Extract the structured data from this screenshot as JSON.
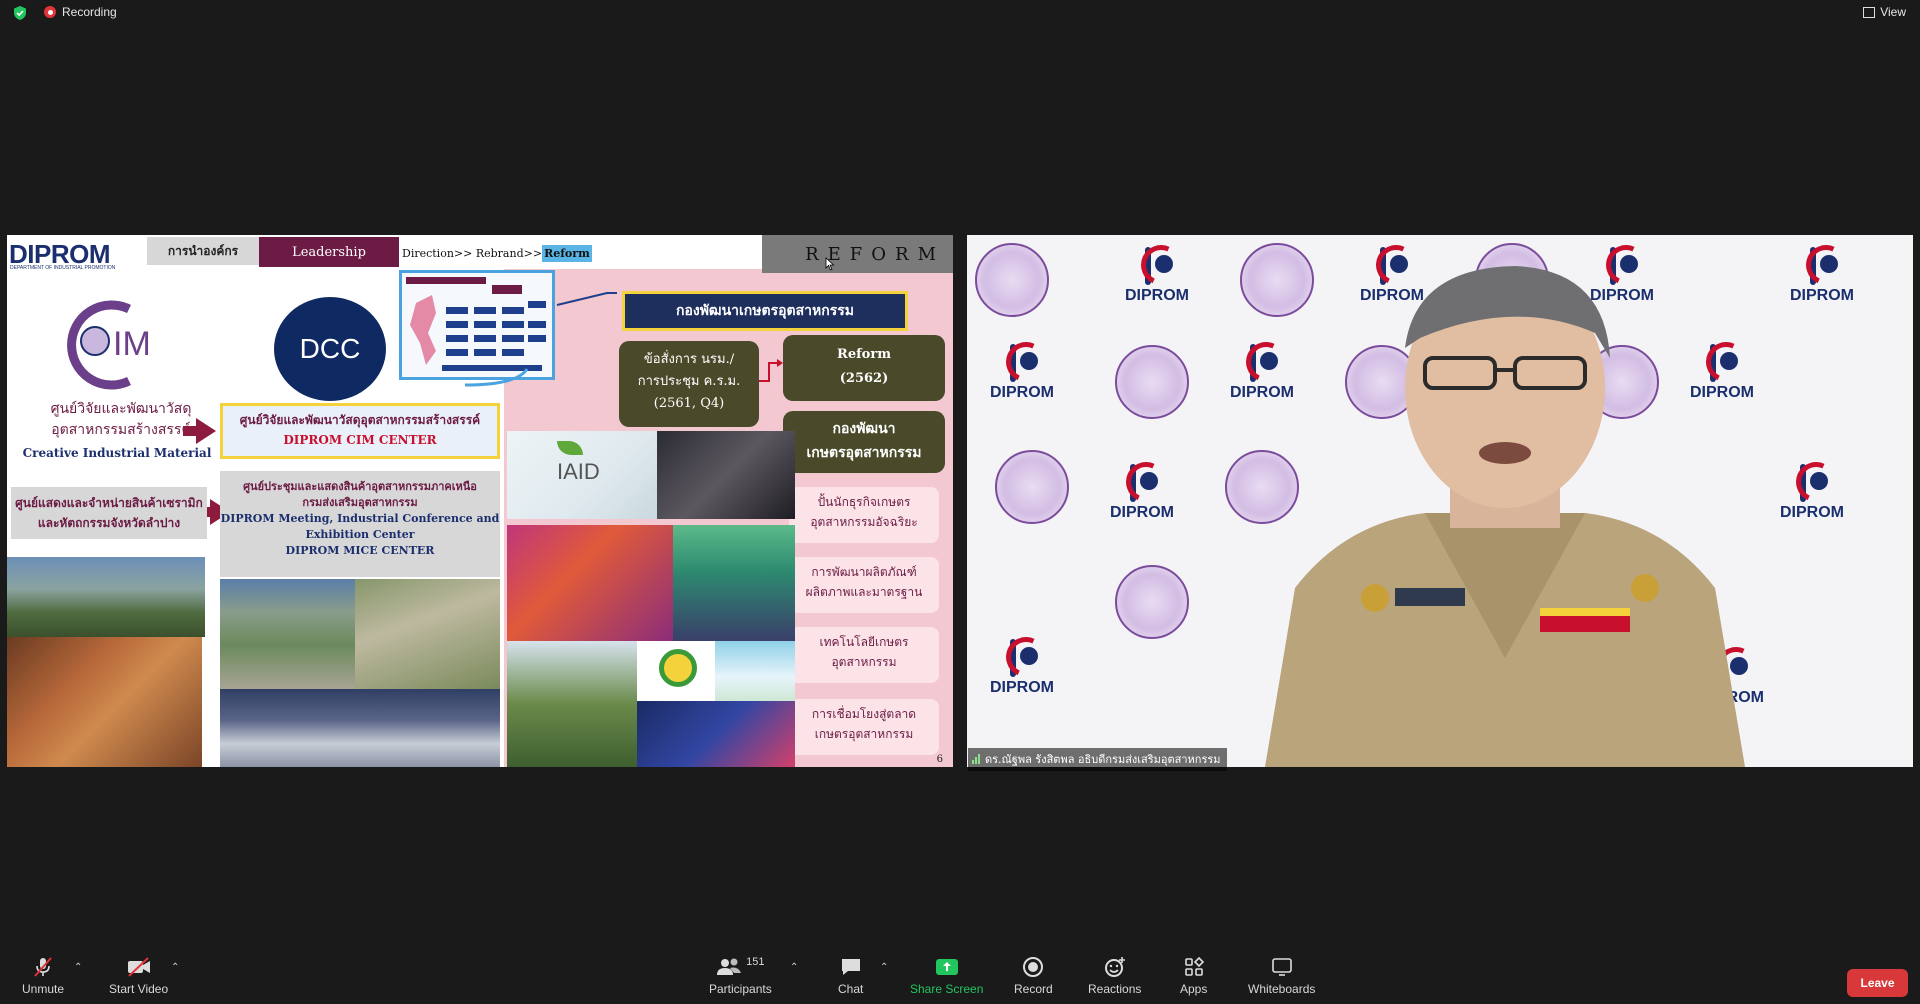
{
  "topbar": {
    "recording_label": "Recording",
    "view_label": "View"
  },
  "slide": {
    "logo_text": "DIPROM",
    "logo_sub": "DEPARTMENT OF INDUSTRIAL PROMOTION",
    "tab_org": "การนำองค์กร",
    "tab_leadership": "Leadership",
    "crumb_prefix": "Direction>> Rebrand>>",
    "crumb_active": "Reform",
    "reform_title": "REFORM",
    "cim_line1": "ศูนย์วิจัยและพัฒนาวัสดุ",
    "cim_line2": "อุตสาหกรรมสร้างสรรค์",
    "cim_en": "Creative Industrial Material",
    "dcc_label": "DCC",
    "cim_box_th": "ศูนย์วิจัยและพัฒนาวัสดุอุตสาหกรรมสร้างสรรค์",
    "cim_box_en": "DIPROM CIM CENTER",
    "lampang_line1": "ศูนย์แสดงและจำหน่ายสินค้าเซรามิก",
    "lampang_line2": "และหัตถกรรมจังหวัดลำปาง",
    "mice_th1": "ศูนย์ประชุมและแสดงสินค้าอุตสาหกรรมภาคเหนือ",
    "mice_th2": "กรมส่งเสริมอุตสาหกรรม",
    "mice_en1": "DIPROM Meeting, Industrial Conference and",
    "mice_en2": "Exhibition Center",
    "mice_en3": "DIPROM MICE CENTER",
    "agri_title": "กองพัฒนาเกษตรอุตสาหกรรม",
    "cmd_line1": "ข้อสั่งการ นรม./",
    "cmd_line2": "การประชุม ค.ร.ม.",
    "cmd_line3": "(2561, Q4)",
    "reform_box_1": "Reform",
    "reform_box_2": "(2562)",
    "div_line1": "กองพัฒนา",
    "div_line2": "เกษตรอุตสาหกรรม",
    "items": [
      {
        "l1": "ปั้นนักธุรกิจเกษตร",
        "l2": "อุตสาหกรรมอัจฉริยะ"
      },
      {
        "l1": "การพัฒนาผลิตภัณฑ์",
        "l2": "ผลิตภาพและมาตรฐาน"
      },
      {
        "l1": "เทคโนโลยีเกษตร",
        "l2": "อุตสาหกรรม"
      },
      {
        "l1": "การเชื่อมโยงสู่ตลาด",
        "l2": "เกษตรอุตสาหกรรม"
      }
    ],
    "iaid_label": "IAID",
    "page_number": "6"
  },
  "video": {
    "diprom_text": "DIPROM",
    "participant_name": "ดร.ณัฐพล รังสิตพล อธิบดีกรมส่งเสริมอุตสาหกรรม"
  },
  "toolbar": {
    "unmute": "Unmute",
    "start_video": "Start Video",
    "participants": "Participants",
    "participants_count": "151",
    "chat": "Chat",
    "share_screen": "Share Screen",
    "record": "Record",
    "reactions": "Reactions",
    "apps": "Apps",
    "whiteboards": "Whiteboards",
    "leave": "Leave"
  },
  "colors": {
    "background": "#1a1a1a",
    "share_accent": "#23c55e",
    "leave": "#d9383a",
    "diprom_blue": "#1b2f6e",
    "maroon": "#6b1b44"
  }
}
